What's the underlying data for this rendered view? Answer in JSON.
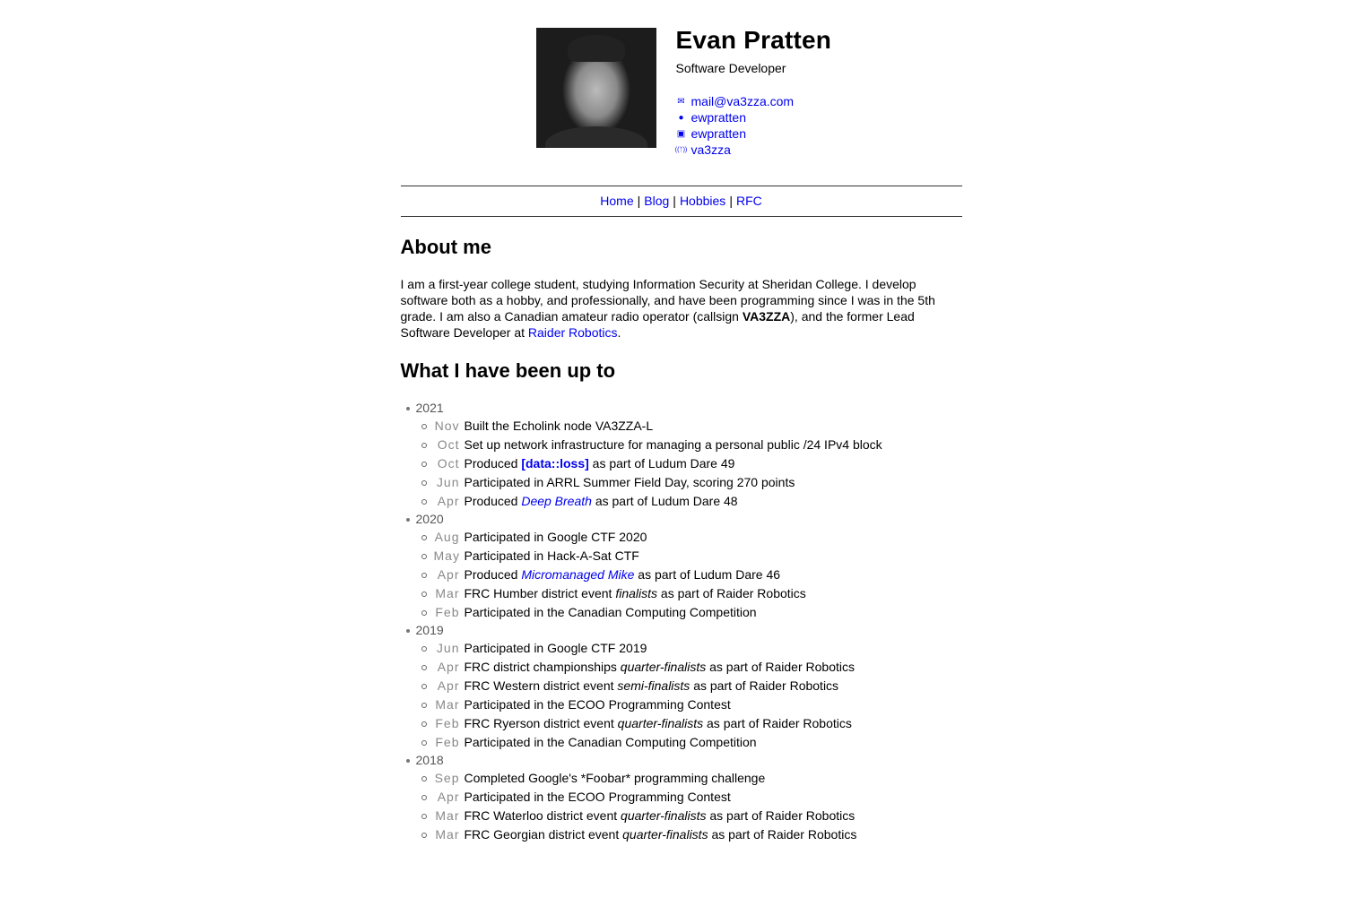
{
  "profile": {
    "name": "Evan Pratten",
    "role": "Software Developer",
    "contacts": [
      {
        "icon": "mail-icon",
        "glyph": "✉",
        "label": "mail@va3zza.com"
      },
      {
        "icon": "github-icon",
        "glyph": "●",
        "label": "ewpratten"
      },
      {
        "icon": "linkedin-icon",
        "glyph": "▣",
        "label": "ewpratten"
      },
      {
        "icon": "radio-tower-icon",
        "glyph": "((ᛉ))",
        "label": "va3zza"
      }
    ]
  },
  "nav": {
    "items": [
      "Home",
      "Blog",
      "Hobbies",
      "RFC"
    ],
    "separator": "|"
  },
  "about": {
    "heading": "About me",
    "segments": [
      {
        "t": "I am a first-year college student, studying Information Security at Sheridan College. I develop software both as a hobby, and professionally, and have been programming since I was in the 5th grade. I am also a Canadian amateur radio operator (callsign "
      },
      {
        "t": "VA3ZZA",
        "s": "b"
      },
      {
        "t": "), and the former Lead Software Developer at "
      },
      {
        "t": "Raider Robotics",
        "s": "link"
      },
      {
        "t": "."
      }
    ]
  },
  "activity": {
    "heading": "What I have been up to",
    "years": [
      {
        "year": "2021",
        "items": [
          {
            "month": "Nov",
            "segments": [
              {
                "t": "Built the Echolink node VA3ZZA-L"
              }
            ]
          },
          {
            "month": "Oct",
            "segments": [
              {
                "t": "Set up network infrastructure for managing a personal public /24 IPv4 block"
              }
            ]
          },
          {
            "month": "Oct",
            "segments": [
              {
                "t": "Produced "
              },
              {
                "t": "[data::loss]",
                "s": "b link"
              },
              {
                "t": " as part of Ludum Dare 49"
              }
            ]
          },
          {
            "month": "Jun",
            "segments": [
              {
                "t": "Participated in ARRL Summer Field Day, scoring 270 points"
              }
            ]
          },
          {
            "month": "Apr",
            "segments": [
              {
                "t": "Produced "
              },
              {
                "t": "Deep Breath",
                "s": "i link"
              },
              {
                "t": " as part of Ludum Dare 48"
              }
            ]
          }
        ]
      },
      {
        "year": "2020",
        "items": [
          {
            "month": "Aug",
            "segments": [
              {
                "t": "Participated in Google CTF 2020"
              }
            ]
          },
          {
            "month": "May",
            "segments": [
              {
                "t": "Participated in Hack-A-Sat CTF"
              }
            ]
          },
          {
            "month": "Apr",
            "segments": [
              {
                "t": "Produced "
              },
              {
                "t": "Micromanaged Mike",
                "s": "i link"
              },
              {
                "t": " as part of Ludum Dare 46"
              }
            ]
          },
          {
            "month": "Mar",
            "segments": [
              {
                "t": "FRC Humber district event "
              },
              {
                "t": "finalists",
                "s": "i"
              },
              {
                "t": " as part of Raider Robotics"
              }
            ]
          },
          {
            "month": "Feb",
            "segments": [
              {
                "t": "Participated in the Canadian Computing Competition"
              }
            ]
          }
        ]
      },
      {
        "year": "2019",
        "items": [
          {
            "month": "Jun",
            "segments": [
              {
                "t": "Participated in Google CTF 2019"
              }
            ]
          },
          {
            "month": "Apr",
            "segments": [
              {
                "t": "FRC district championships "
              },
              {
                "t": "quarter-finalists",
                "s": "i"
              },
              {
                "t": " as part of Raider Robotics"
              }
            ]
          },
          {
            "month": "Apr",
            "segments": [
              {
                "t": "FRC Western district event "
              },
              {
                "t": "semi-finalists",
                "s": "i"
              },
              {
                "t": " as part of Raider Robotics"
              }
            ]
          },
          {
            "month": "Mar",
            "segments": [
              {
                "t": "Participated in the ECOO Programming Contest"
              }
            ]
          },
          {
            "month": "Feb",
            "segments": [
              {
                "t": "FRC Ryerson district event "
              },
              {
                "t": "quarter-finalists",
                "s": "i"
              },
              {
                "t": " as part of Raider Robotics"
              }
            ]
          },
          {
            "month": "Feb",
            "segments": [
              {
                "t": "Participated in the Canadian Computing Competition"
              }
            ]
          }
        ]
      },
      {
        "year": "2018",
        "items": [
          {
            "month": "Sep",
            "segments": [
              {
                "t": "Completed Google's *Foobar* programming challenge"
              }
            ]
          },
          {
            "month": "Apr",
            "segments": [
              {
                "t": "Participated in the ECOO Programming Contest"
              }
            ]
          },
          {
            "month": "Mar",
            "segments": [
              {
                "t": "FRC Waterloo district event "
              },
              {
                "t": "quarter-finalists",
                "s": "i"
              },
              {
                "t": " as part of Raider Robotics"
              }
            ]
          },
          {
            "month": "Mar",
            "segments": [
              {
                "t": "FRC Georgian district event "
              },
              {
                "t": "quarter-finalists",
                "s": "i"
              },
              {
                "t": " as part of Raider Robotics"
              }
            ]
          }
        ]
      }
    ]
  }
}
